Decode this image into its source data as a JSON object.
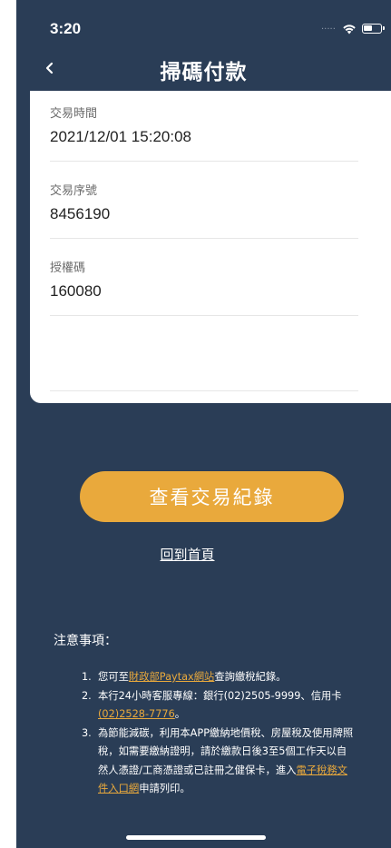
{
  "status_bar": {
    "time": "3:20",
    "signal": "....."
  },
  "header": {
    "title": "掃碼付款",
    "back_icon": "chevron-left-icon"
  },
  "details": [
    {
      "label": "交易時間",
      "value": "2021/12/01 15:20:08"
    },
    {
      "label": "交易序號",
      "value": "8456190"
    },
    {
      "label": "授權碼",
      "value": "160080"
    }
  ],
  "actions": {
    "view_records_label": "查看交易紀錄",
    "home_link_label": "回到首頁"
  },
  "notes": {
    "title": "注意事項：",
    "items": [
      {
        "num": "1.",
        "before": "您可至",
        "link": "財政部Paytax網站",
        "after": "查詢繳稅紀錄。"
      },
      {
        "num": "2.",
        "before": "本行24小時客服專線：銀行(02)2505-9999、信用卡",
        "link": "(02)2528-7776",
        "after": "。"
      },
      {
        "num": "3.",
        "before": "為節能減碳，利用本APP繳納地價稅、房屋稅及使用牌照稅，如需要繳納證明，請於繳款日後3至5個工作天以自然人憑證/工商憑證或已註冊之健保卡，進入",
        "link": "電子稅務文件入口網",
        "after": "申請列印。"
      }
    ]
  },
  "colors": {
    "background": "#2a3d56",
    "accent": "#e9a93c",
    "card": "#ffffff"
  }
}
